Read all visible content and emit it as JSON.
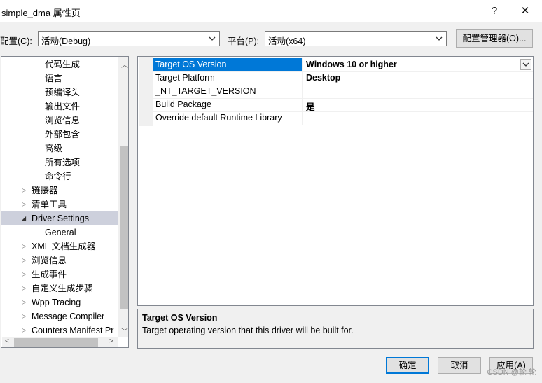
{
  "window": {
    "title": "simple_dma 属性页",
    "help_glyph": "?",
    "close_glyph": "✕"
  },
  "toolbar": {
    "config_label": "配置(C):",
    "config_value": "活动(Debug)",
    "platform_label": "平台(P):",
    "platform_value": "活动(x64)",
    "config_manager_label": "配置管理器(O)..."
  },
  "tree": {
    "items": [
      {
        "label": "代码生成",
        "expander": ""
      },
      {
        "label": "语言",
        "expander": ""
      },
      {
        "label": "预编译头",
        "expander": ""
      },
      {
        "label": "输出文件",
        "expander": ""
      },
      {
        "label": "浏览信息",
        "expander": ""
      },
      {
        "label": "外部包含",
        "expander": ""
      },
      {
        "label": "高级",
        "expander": ""
      },
      {
        "label": "所有选项",
        "expander": ""
      },
      {
        "label": "命令行",
        "expander": ""
      },
      {
        "label": "链接器",
        "expander": "▷"
      },
      {
        "label": "清单工具",
        "expander": "▷"
      },
      {
        "label": "Driver Settings",
        "expander": "◢"
      },
      {
        "label": "General",
        "expander": ""
      },
      {
        "label": "XML 文档生成器",
        "expander": "▷"
      },
      {
        "label": "浏览信息",
        "expander": "▷"
      },
      {
        "label": "生成事件",
        "expander": "▷"
      },
      {
        "label": "自定义生成步骤",
        "expander": "▷"
      },
      {
        "label": "Wpp Tracing",
        "expander": "▷"
      },
      {
        "label": "Message Compiler",
        "expander": "▷"
      },
      {
        "label": "Counters Manifest Pr",
        "expander": "▷"
      }
    ],
    "selected_index": 11
  },
  "properties": {
    "rows": [
      {
        "name": "Target OS Version",
        "value": "Windows 10 or higher"
      },
      {
        "name": "Target Platform",
        "value": "Desktop"
      },
      {
        "name": "_NT_TARGET_VERSION",
        "value": ""
      },
      {
        "name": "Build Package",
        "value": "是"
      },
      {
        "name": "Override default Runtime Library",
        "value": ""
      }
    ],
    "selected_index": 0
  },
  "description": {
    "title": "Target OS Version",
    "text": "Target operating version that this driver will be built for."
  },
  "buttons": {
    "ok": "确定",
    "cancel": "取消",
    "apply": "应用(A)"
  },
  "watermark": "CSDN @轮 轮",
  "colors": {
    "selection_blue": "#0078d7",
    "tree_selection": "#cdd0dc"
  }
}
